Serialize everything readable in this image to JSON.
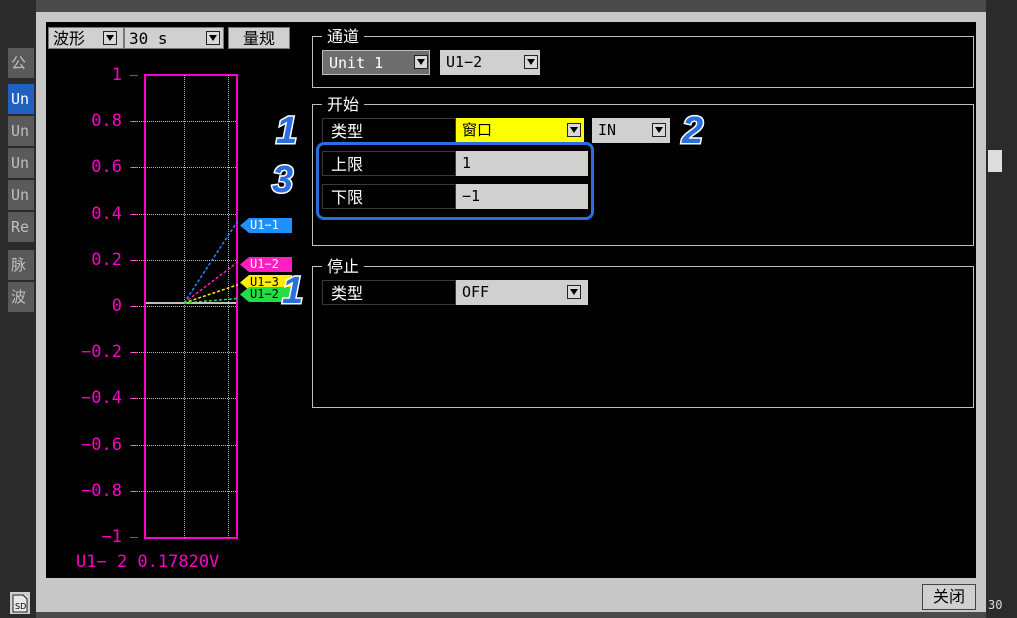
{
  "side_tabs": [
    "公",
    "Un",
    "Un",
    "Un",
    "Un",
    "Re",
    "脉",
    "波"
  ],
  "bottom_left_icon": "sd-card-icon",
  "right_strip": {
    "partial_text": "30"
  },
  "waveform": {
    "mode": "波形",
    "time": "30 s",
    "scale_button": "量规",
    "y_ticks": [
      "1",
      "0.8",
      "0.6",
      "0.4",
      "0.2",
      "0",
      "−0.2",
      "−0.4",
      "−0.6",
      "−0.8",
      "−1"
    ],
    "readout": "U1− 2 0.17820V",
    "channels": [
      {
        "label": "U1−1",
        "value": 0.36,
        "color": "#1e90ff"
      },
      {
        "label": "U1−2",
        "value": 0.18,
        "color": "#ff1ebe"
      },
      {
        "label": "U1−3",
        "value": 0.08,
        "color": "#ffee00"
      },
      {
        "label": "U1−2",
        "value": 0.02,
        "color": "#22dd44"
      }
    ]
  },
  "channel_group": {
    "title": "通道",
    "unit": "Unit 1",
    "channel": "U1−2"
  },
  "start_group": {
    "title": "开始",
    "type_label": "类型",
    "type_value": "窗口",
    "direction_value": "IN",
    "upper_label": "上限",
    "upper_value": "1",
    "lower_label": "下限",
    "lower_value": "−1"
  },
  "stop_group": {
    "title": "停止",
    "type_label": "类型",
    "type_value": "OFF"
  },
  "callouts": {
    "start_type": "1",
    "direction": "2",
    "limits": "3",
    "stop_type": "1"
  },
  "close_label": "关闭",
  "colors": {
    "accent": "#2060c0",
    "axis": "#ff00c8",
    "highlight": "#ffff00",
    "callout": "#2a6fe0"
  }
}
